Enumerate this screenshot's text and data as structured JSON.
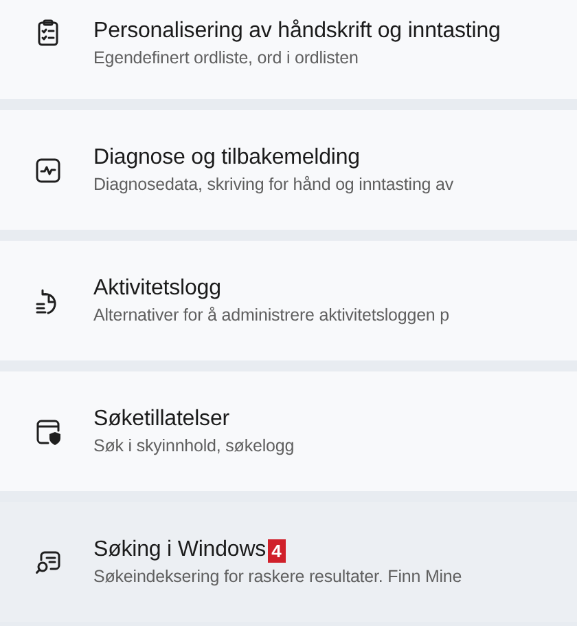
{
  "items": [
    {
      "title": "Personalisering av håndskrift og inntasting",
      "subtitle": "Egendefinert ordliste, ord i ordlisten",
      "highlighted": false
    },
    {
      "title": "Diagnose og tilbakemelding",
      "subtitle": "Diagnosedata, skriving for hånd og inntasting av",
      "highlighted": false
    },
    {
      "title": "Aktivitetslogg",
      "subtitle": "Alternativer for å administrere aktivitetsloggen p",
      "highlighted": false
    },
    {
      "title": "Søketillatelser",
      "subtitle": "Søk i skyinnhold, søkelogg",
      "highlighted": false
    },
    {
      "title": "Søking i Windows",
      "badge": "4",
      "subtitle": "Søkeindeksering for raskere resultater. Finn Mine",
      "highlighted": true
    }
  ]
}
